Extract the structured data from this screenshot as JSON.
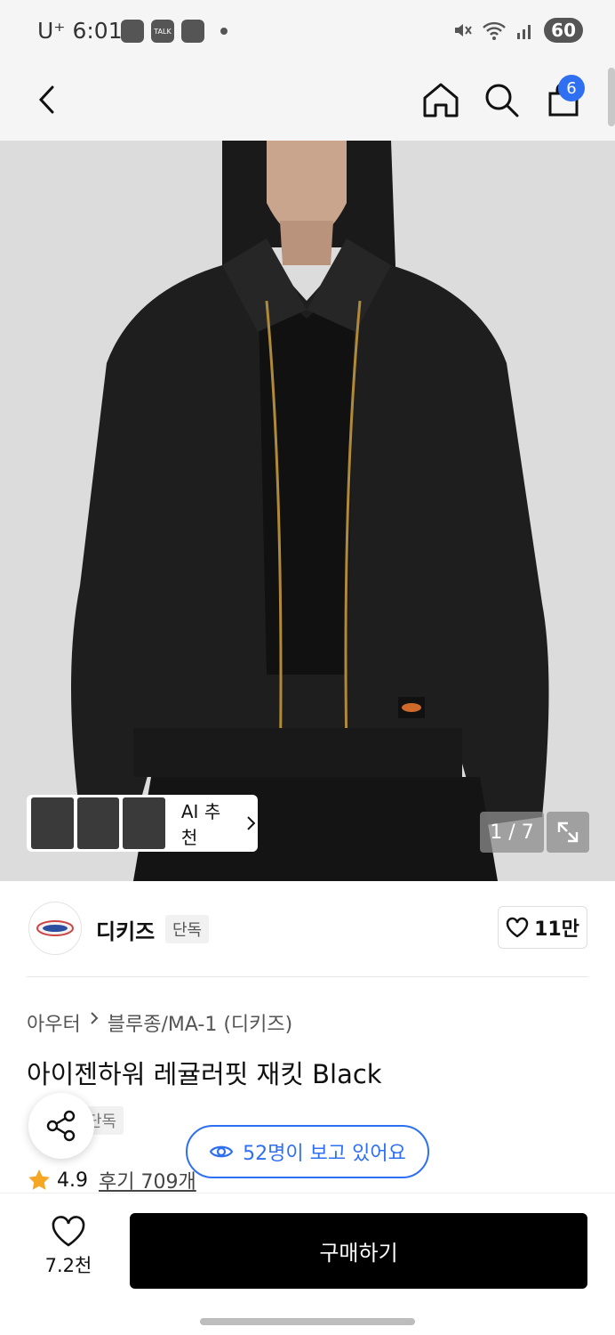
{
  "status_bar": {
    "carrier": "U⁺",
    "time": "6:01",
    "talk": "TALK",
    "battery": "60"
  },
  "header": {
    "cart_count": "6"
  },
  "hero": {
    "page_indicator": "1 / 7",
    "ai_label": "AI 추천"
  },
  "brand": {
    "name": "디키즈",
    "badge": "단독",
    "likes": "11만"
  },
  "product": {
    "breadcrumb": [
      "아우터",
      "블루종/MA-1 (디키즈)"
    ],
    "title": "아이젠하워 레귤러핏 재킷 Black",
    "tag": "단독",
    "rating": "4.9",
    "reviews": "후기 709개",
    "viewers": "52명이 보고 있어요"
  },
  "bottom": {
    "wish_count": "7.2천",
    "buy_label": "구매하기"
  },
  "colors": {
    "accent": "#2f6ff2",
    "star": "#f5a623",
    "buy_bg": "#000000"
  }
}
